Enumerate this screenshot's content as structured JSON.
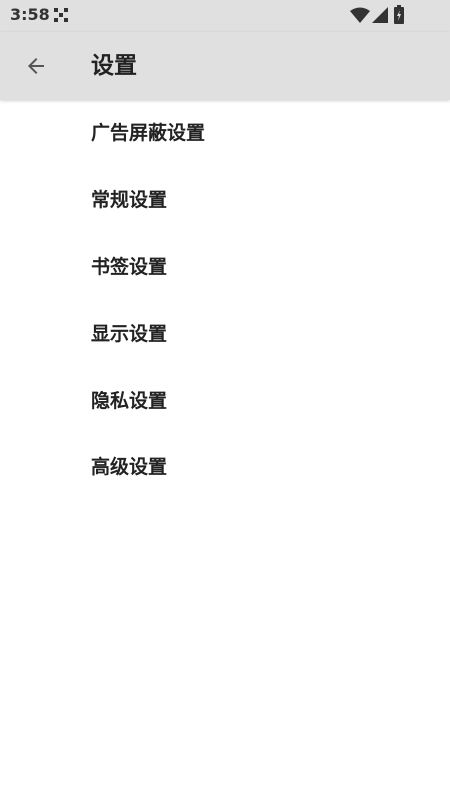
{
  "status_bar": {
    "time": "3:58",
    "icons": [
      "notification-icon",
      "wifi-icon",
      "cellular-signal-icon",
      "battery-charging-icon"
    ]
  },
  "app_bar": {
    "back_icon": "arrow-left-icon",
    "title": "设置"
  },
  "settings": {
    "items": [
      {
        "label": "广告屏蔽设置",
        "name": "settings-item-ad-block"
      },
      {
        "label": "常规设置",
        "name": "settings-item-general"
      },
      {
        "label": "书签设置",
        "name": "settings-item-bookmarks"
      },
      {
        "label": "显示设置",
        "name": "settings-item-display"
      },
      {
        "label": "隐私设置",
        "name": "settings-item-privacy"
      },
      {
        "label": "高级设置",
        "name": "settings-item-advanced"
      }
    ]
  },
  "colors": {
    "bar_background": "#e0e0e0",
    "page_background": "#ffffff",
    "text": "#222222",
    "icon": "#555555"
  }
}
